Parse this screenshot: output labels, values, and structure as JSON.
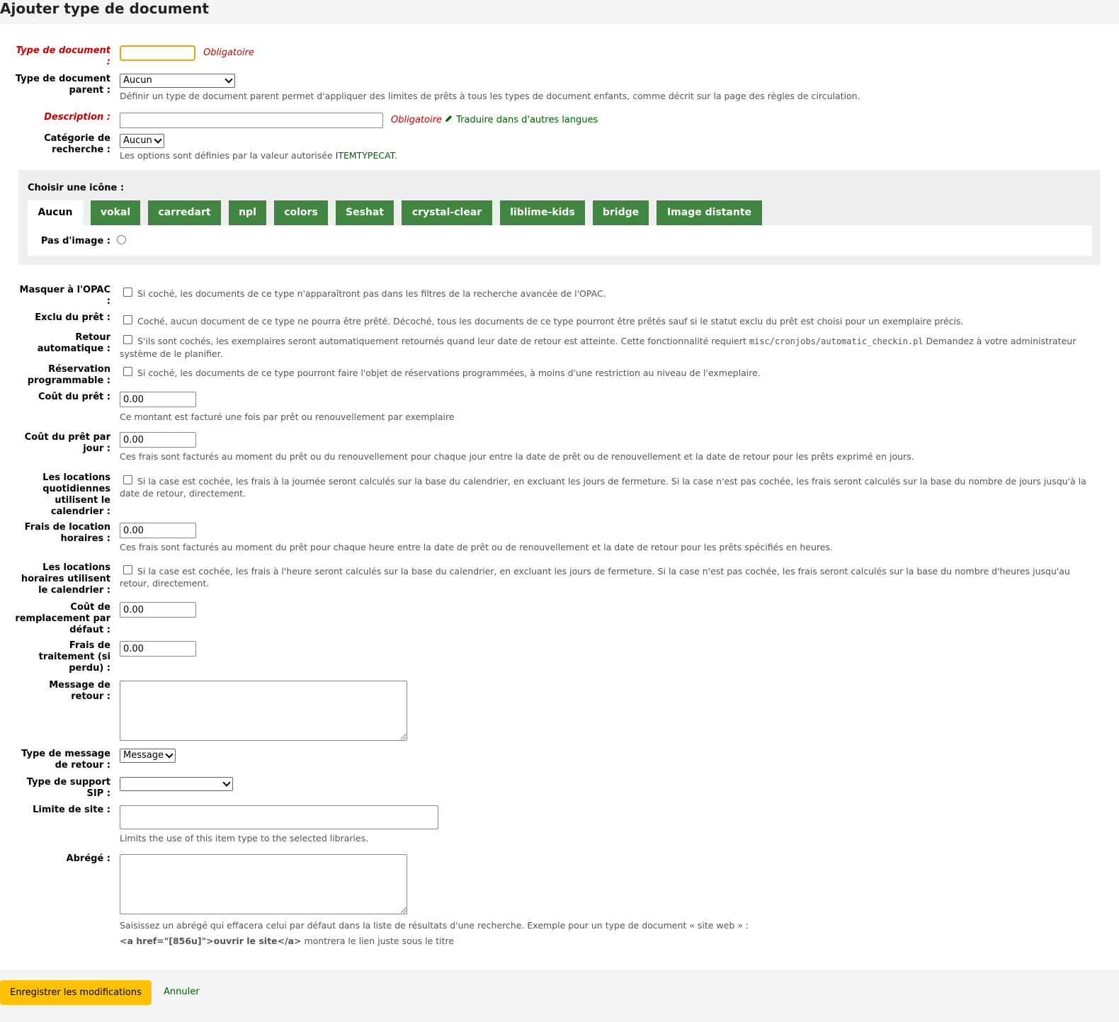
{
  "page_title": "Ajouter type de document",
  "fields": {
    "itemtype": {
      "label": "Type de document :",
      "value": "",
      "required_note": "Obligatoire"
    },
    "parent": {
      "label": "Type de document parent :",
      "value": "Aucun",
      "hint": "Définir un type de document parent permet d'appliquer des limites de prêts à tous les types de document enfants, comme décrit sur la page des règles de circulation."
    },
    "description": {
      "label": "Description :",
      "value": "",
      "required_note": "Obligatoire",
      "translate_label": "Traduire dans d'autres langues"
    },
    "searchcategory": {
      "label": "Catégorie de recherche :",
      "value": "Aucun",
      "hint_prefix": "Les options sont définies par la valeur autorisée ",
      "hint_link": "ITEMTYPECAT",
      "hint_suffix": "."
    },
    "hide_opac": {
      "label": "Masquer à l'OPAC :",
      "hint": "Si coché, les documents de ce type n'apparaîtront pas dans les filtres de la recherche avancée de l'OPAC."
    },
    "notforloan": {
      "label": "Exclu du prêt :",
      "hint": "Coché, aucun document de ce type ne pourra être prêté. Décoché, tous les documents de ce type pourront être prêtés sauf si le statut exclu du prêt est choisi pour un exemplaire précis."
    },
    "auto_checkin": {
      "label": "Retour automatique :",
      "hint_prefix": "S'ils sont cochés, les exemplaires seront automatiquement retournés quand leur date de retour est atteinte. Cette fonctionnalité requiert ",
      "hint_code": "misc/cronjobs/automatic_checkin.pl",
      "hint_suffix": " Demandez à votre administrateur système de le planifier."
    },
    "bookable": {
      "label": "Réservation programmable :",
      "hint": "Si coché, les documents de ce type pourront faire l'objet de réservations programmées, à moins d'une restriction au niveau de l'exmeplaire."
    },
    "rentalcharge": {
      "label": "Coût du prêt :",
      "value": "0.00",
      "hint": "Ce montant est facturé une fois par prêt ou renouvellement par exemplaire"
    },
    "rentalcharge_daily": {
      "label": "Coût du prêt par jour :",
      "value": "0.00",
      "hint": "Ces frais sont facturés au moment du prêt ou du renouvellement pour chaque jour entre la date de prêt ou de renouvellement et la date de retour pour les prêts exprimé en jours."
    },
    "daily_calendar": {
      "label": "Les locations quotidiennes utilisent le calendrier :",
      "hint": "Si la case est cochée, les frais à la journée seront calculés sur la base du calendrier, en excluant les jours de fermeture. Si la case n'est pas cochée, les frais seront calculés sur la base du nombre de jours jusqu'à la date de retour, directement."
    },
    "rentalcharge_hourly": {
      "label": "Frais de location horaires :",
      "value": "0.00",
      "hint": "Ces frais sont facturés au moment du prêt pour chaque heure entre la date de prêt ou de renouvellement et la date de retour pour les prêts spécifiés en heures."
    },
    "hourly_calendar": {
      "label": "Les locations horaires utilisent le calendrier :",
      "hint": "Si la case est cochée, les frais à l'heure seront calculés sur la base du calendrier, en excluant les jours de fermeture. Si la case n'est pas cochée, les frais seront calculés sur la base du nombre d'heures jusqu'au retour, directement."
    },
    "defaultreplacecost": {
      "label": "Coût de remplacement par défaut :",
      "value": "0.00"
    },
    "processfee": {
      "label": "Frais de traitement (si perdu) :",
      "value": "0.00"
    },
    "checkinmsg": {
      "label": "Message de retour :",
      "value": ""
    },
    "checkinmsgtype": {
      "label": "Type de message de retour :",
      "value": "Message"
    },
    "sip_media_type": {
      "label": "Type de support SIP :",
      "value": ""
    },
    "branches": {
      "label": "Limite de site :",
      "value": "",
      "hint": "Limits the use of this item type to the selected libraries."
    },
    "summary": {
      "label": "Abrégé :",
      "value": "",
      "hint1": "Saisissez un abrégé qui effacera celui par défaut dans la liste de résultats d'une recherche. Exemple pour un type de document « site web » :",
      "hint2_code": "<a href=\"[856u]\">ouvrir le site</a>",
      "hint2_suffix": " montrera le lien juste sous le titre"
    }
  },
  "icons": {
    "label": "Choisir une icône :",
    "tabs": [
      "Aucun",
      "vokal",
      "carredart",
      "npl",
      "colors",
      "Seshat",
      "crystal-clear",
      "liblime-kids",
      "bridge",
      "Image distante"
    ],
    "no_image_label": "Pas d'image :"
  },
  "actions": {
    "save": "Enregistrer les modifications",
    "cancel": "Annuler"
  },
  "colors": {
    "accent_green": "#408540",
    "required_red": "#cc0000",
    "save_yellow": "#ffc107",
    "focus_orange": "#e8a317"
  }
}
